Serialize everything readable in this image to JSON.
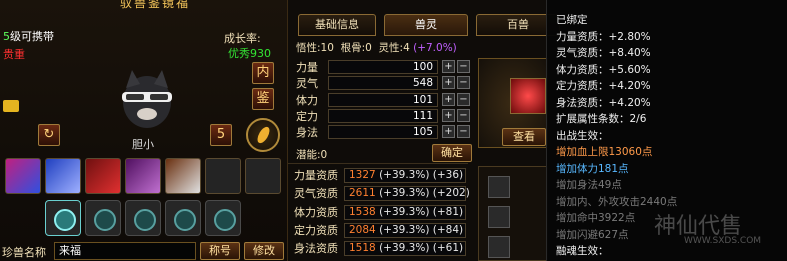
{
  "window": {
    "title": "驭兽鉴镜福"
  },
  "pet": {
    "level_num": "5",
    "level_text": "级可携带",
    "rarity": "贵重",
    "growth_label": "成长率:",
    "growth_value": "优秀930",
    "name": "胆小",
    "buttons": {
      "nei": "内",
      "jian": "鉴",
      "rotate_left": "↻",
      "five": "5"
    },
    "name_label": "珍兽名称",
    "name_value": "来福",
    "title_button": "称号",
    "modify_button": "修改"
  },
  "tabs": [
    "基础信息",
    "兽灵",
    "百兽"
  ],
  "traits": {
    "wuxing_label": "悟性:",
    "wuxing_value": "10",
    "gengu_label": "根骨:",
    "gengu_value": "0",
    "lingxing_label": "灵性:",
    "lingxing_value": "4",
    "lingxing_bonus": "(+7.0%)"
  },
  "attributes": [
    {
      "label": "力量",
      "value": "100"
    },
    {
      "label": "灵气",
      "value": "548"
    },
    {
      "label": "体力",
      "value": "101"
    },
    {
      "label": "定力",
      "value": "111"
    },
    {
      "label": "身法",
      "value": "105"
    }
  ],
  "potential": {
    "label": "潜能:",
    "value": "0",
    "confirm": "确定"
  },
  "aptitudes": [
    {
      "label": "力量资质",
      "base": "1327",
      "pct": "(+39.3%)",
      "add": "(+36)"
    },
    {
      "label": "灵气资质",
      "base": "2611",
      "pct": "(+39.3%)",
      "add": "(+202)"
    },
    {
      "label": "体力资质",
      "base": "1538",
      "pct": "(+39.3%)",
      "add": "(+81)"
    },
    {
      "label": "定力资质",
      "base": "2084",
      "pct": "(+39.3%)",
      "add": "(+84)"
    },
    {
      "label": "身法资质",
      "base": "1518",
      "pct": "(+39.3%)",
      "add": "(+61)"
    }
  ],
  "book": {
    "view_button": "查看"
  },
  "tooltip": {
    "lines": [
      {
        "text": "已绑定",
        "color": "white"
      },
      {
        "text": "力量资质：+2.80%",
        "color": "white"
      },
      {
        "text": "灵气资质：+8.40%",
        "color": "white"
      },
      {
        "text": "体力资质：+5.60%",
        "color": "white"
      },
      {
        "text": "定力资质：+4.20%",
        "color": "white"
      },
      {
        "text": "身法资质：+4.20%",
        "color": "white"
      },
      {
        "text": "扩展属性条数：2/6",
        "color": "white"
      },
      {
        "text": "出战生效：",
        "color": "white"
      },
      {
        "text": "增加血上限13060点",
        "color": "orange"
      },
      {
        "text": "增加体力181点",
        "color": "blue"
      },
      {
        "text": "增加身法49点",
        "color": "dim"
      },
      {
        "text": "增加内、外攻攻击2440点",
        "color": "dim"
      },
      {
        "text": "增加命中3922点",
        "color": "dim"
      },
      {
        "text": "增加闪避627点",
        "color": "dim"
      },
      {
        "text": "融魂生效：",
        "color": "white"
      }
    ]
  },
  "watermark": {
    "text": "神仙代售",
    "url": "WWW.SXDS.COM"
  }
}
